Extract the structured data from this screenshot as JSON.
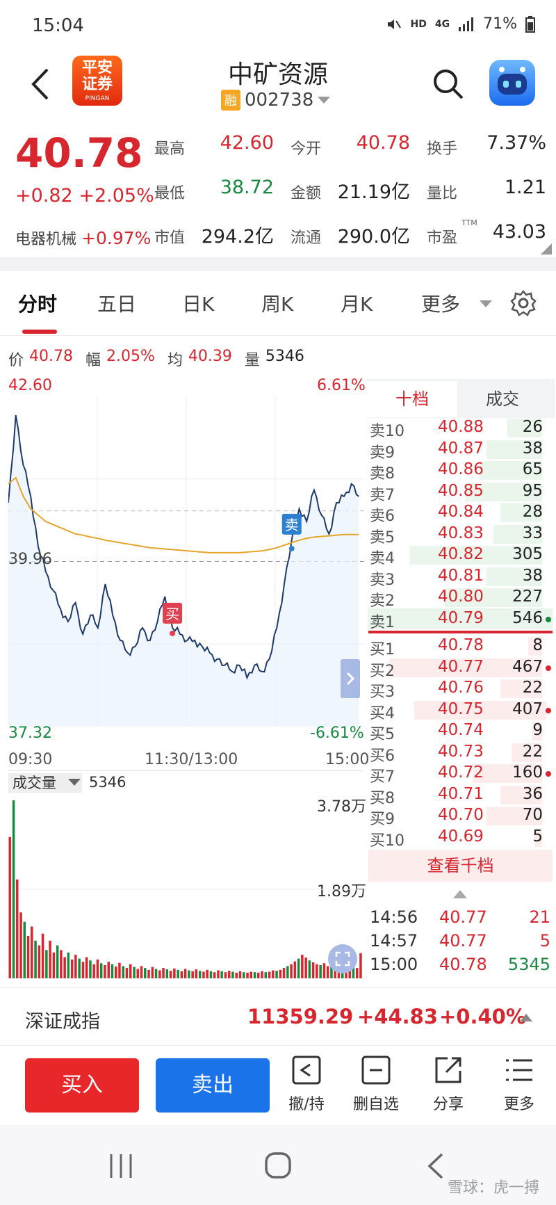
{
  "status_bar": {
    "time": "15:04",
    "indicators": [
      "HD",
      "4G"
    ],
    "battery": "71%"
  },
  "header": {
    "back_icon": "chevron-left-icon",
    "logo_line1": "平安",
    "logo_line2": "证券",
    "logo_sub": "PINGAN",
    "stock_name": "中矿资源",
    "margin_badge": "融",
    "stock_code": "002738",
    "search_icon": "search-icon",
    "assistant_icon": "robot-icon"
  },
  "quote": {
    "price": "40.78",
    "change": "+0.82",
    "change_pct": "+2.05%",
    "sector_name": "电器机械",
    "sector_pct": "+0.97%",
    "fields": [
      {
        "label": "最高",
        "value": "42.60",
        "color": "red"
      },
      {
        "label": "今开",
        "value": "40.78",
        "color": "red"
      },
      {
        "label": "换手",
        "value": "7.37%",
        "color": "dark"
      },
      {
        "label": "最低",
        "value": "38.72",
        "color": "green"
      },
      {
        "label": "金额",
        "value": "21.19亿",
        "color": "dark"
      },
      {
        "label": "量比",
        "value": "1.21",
        "color": "dark"
      },
      {
        "label": "市值",
        "value": "294.2亿",
        "color": "dark"
      },
      {
        "label": "流通",
        "value": "290.0亿",
        "color": "dark"
      },
      {
        "label": "市盈",
        "value": "43.03",
        "color": "dark"
      }
    ],
    "pe_superscript": "TTM"
  },
  "tabs": [
    "分时",
    "五日",
    "日K",
    "周K",
    "月K",
    "更多"
  ],
  "chart_info": {
    "price_label": "价",
    "price": "40.78",
    "range_label": "幅",
    "range": "2.05%",
    "avg_label": "均",
    "avg": "40.39",
    "vol_label": "量",
    "vol": "5346"
  },
  "chart_data": {
    "type": "line",
    "y_top": "42.60",
    "y_mid": "39.96",
    "y_bottom": "37.32",
    "pct_top": "6.61%",
    "pct_bottom": "-6.61%",
    "ylim": [
      37.32,
      42.6
    ],
    "x_labels": [
      "09:30",
      "11:30/13:00",
      "15:00"
    ],
    "prev_close": 39.96,
    "series": [
      {
        "values": [
          40.9,
          42.3,
          41.5,
          41.0,
          40.2,
          39.8,
          39.5,
          39.2,
          39.0,
          39.3,
          38.8,
          39.1,
          38.9,
          39.6,
          39.1,
          38.7,
          38.5,
          38.6,
          38.9,
          38.7,
          39.0,
          39.4,
          38.9,
          38.8,
          38.7,
          38.7,
          38.6,
          38.5,
          38.4,
          38.3,
          38.2,
          38.3,
          38.1,
          38.3,
          38.2,
          38.4,
          38.9,
          39.6,
          40.3,
          40.8,
          40.6,
          41.1,
          40.7,
          40.4,
          40.9,
          41.0,
          41.2,
          41.0
        ]
      },
      {
        "values": [
          41.2,
          41.3,
          41.0,
          40.8,
          40.7,
          40.6,
          40.55,
          40.5,
          40.45,
          40.4,
          40.38,
          40.35,
          40.33,
          40.3,
          40.28,
          40.26,
          40.24,
          40.22,
          40.2,
          40.18,
          40.17,
          40.16,
          40.15,
          40.14,
          40.13,
          40.12,
          40.11,
          40.1,
          40.1,
          40.1,
          40.1,
          40.1,
          40.11,
          40.12,
          40.13,
          40.15,
          40.18,
          40.22,
          40.26,
          40.3,
          40.33,
          40.35,
          40.36,
          40.37,
          40.38,
          40.39,
          40.39,
          40.39
        ]
      }
    ],
    "markers": [
      {
        "label": "买",
        "x_index": 22,
        "value": 38.9,
        "color": "#e04050"
      },
      {
        "label": "卖",
        "x_index": 38,
        "value": 40.3,
        "color": "#2d7fd0"
      }
    ],
    "volume": {
      "label": "成交量",
      "current": "5346",
      "y_top": "3.78万",
      "y_mid": "1.89万",
      "ylim": [
        0,
        37800
      ],
      "values": [
        30000,
        37800,
        21000,
        14000,
        12000,
        9000,
        11000,
        8000,
        7000,
        9500,
        6000,
        8000,
        5500,
        7000,
        6000,
        4500,
        5500,
        4000,
        5000,
        4200,
        3500,
        4500,
        3800,
        3000,
        4000,
        3200,
        2800,
        3500,
        3000,
        2500,
        3300,
        2600,
        2200,
        3000,
        2400,
        2000,
        2600,
        2200,
        1800,
        2400,
        2000,
        1700,
        2200,
        1900,
        1600,
        2100,
        1800,
        1500,
        2000,
        1700,
        1500,
        1900,
        1600,
        1400,
        1800,
        1500,
        1300,
        1700,
        1500,
        1300,
        1600,
        1400,
        1200,
        1500,
        1300,
        1200,
        1400,
        1300,
        1200,
        1500,
        1300,
        1400,
        1700,
        1600,
        1800,
        2200,
        2600,
        3000,
        3600,
        4200,
        5000,
        4400,
        3800,
        3400,
        3000,
        2800,
        3200,
        2600,
        2400,
        2800,
        2200,
        2600,
        2000,
        2400,
        3000,
        2200,
        5346
      ]
    }
  },
  "order_book": {
    "tab_active": "十档",
    "tab_other": "成交",
    "sells": [
      {
        "label": "卖10",
        "price": "40.88",
        "vol": "26"
      },
      {
        "label": "卖9",
        "price": "40.87",
        "vol": "38"
      },
      {
        "label": "卖8",
        "price": "40.86",
        "vol": "65"
      },
      {
        "label": "卖7",
        "price": "40.85",
        "vol": "95"
      },
      {
        "label": "卖6",
        "price": "40.84",
        "vol": "28"
      },
      {
        "label": "卖5",
        "price": "40.83",
        "vol": "33"
      },
      {
        "label": "卖4",
        "price": "40.82",
        "vol": "305"
      },
      {
        "label": "卖3",
        "price": "40.81",
        "vol": "38"
      },
      {
        "label": "卖2",
        "price": "40.80",
        "vol": "227"
      },
      {
        "label": "卖1",
        "price": "40.79",
        "vol": "546"
      }
    ],
    "buys": [
      {
        "label": "买1",
        "price": "40.78",
        "vol": "8"
      },
      {
        "label": "买2",
        "price": "40.77",
        "vol": "467"
      },
      {
        "label": "买3",
        "price": "40.76",
        "vol": "22"
      },
      {
        "label": "买4",
        "price": "40.75",
        "vol": "407"
      },
      {
        "label": "买5",
        "price": "40.74",
        "vol": "9"
      },
      {
        "label": "买6",
        "price": "40.73",
        "vol": "22"
      },
      {
        "label": "买7",
        "price": "40.72",
        "vol": "160"
      },
      {
        "label": "买8",
        "price": "40.71",
        "vol": "36"
      },
      {
        "label": "买9",
        "price": "40.70",
        "vol": "70"
      },
      {
        "label": "买10",
        "price": "40.69",
        "vol": "5"
      }
    ],
    "view_more": "查看千档",
    "ticks": [
      {
        "time": "14:56",
        "price": "40.77",
        "vol": "21",
        "color": "red"
      },
      {
        "time": "14:57",
        "price": "40.77",
        "vol": "5",
        "color": "red"
      },
      {
        "time": "15:00",
        "price": "40.78",
        "vol": "5345",
        "color": "green"
      }
    ]
  },
  "index_bar": {
    "name": "深证成指",
    "value": "11359.29",
    "change": "+44.83",
    "pct": "+0.40%"
  },
  "actions": {
    "buy": "买入",
    "sell": "卖出",
    "items": [
      {
        "label": "撤/持",
        "icon": "withdraw-icon"
      },
      {
        "label": "删自选",
        "icon": "remove-watchlist-icon"
      },
      {
        "label": "分享",
        "icon": "share-icon"
      },
      {
        "label": "更多",
        "icon": "menu-icon"
      }
    ]
  },
  "watermark": "雪球：虎一搏",
  "colors": {
    "up": "#d8262f",
    "down": "#168a3f",
    "price_line": "#1d3a6b",
    "avg_line": "#e5a42a",
    "sell_button": "#1a73e8",
    "buy_button": "#e8272a"
  }
}
